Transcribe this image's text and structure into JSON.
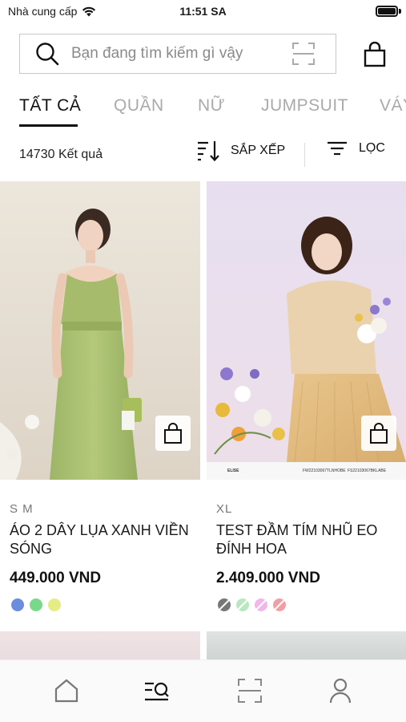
{
  "status_bar": {
    "carrier": "Nhà cung cấp",
    "time": "11:51 SA"
  },
  "search": {
    "placeholder": "Bạn đang tìm kiếm gì vậy",
    "value": ""
  },
  "tabs": [
    {
      "label": "TẤT CẢ",
      "active": true
    },
    {
      "label": "QUẦN",
      "active": false
    },
    {
      "label": "NỮ",
      "active": false
    },
    {
      "label": "JUMPSUIT",
      "active": false
    },
    {
      "label": "VÁY",
      "active": false
    }
  ],
  "results": {
    "count_label": "14730 Kết quả"
  },
  "sort_label": "SẮP XẾP",
  "filter_label": "LỌC",
  "products": [
    {
      "sizes": "S  M",
      "name": "ÁO 2 DÂY LỤA XANH VIỀN SÓNG",
      "price": "449.000 VND",
      "colors": [
        {
          "hex": "#6b8de0",
          "unavailable": false
        },
        {
          "hex": "#78d98b",
          "unavailable": false
        },
        {
          "hex": "#e5ec84",
          "unavailable": false
        }
      ]
    },
    {
      "sizes": "XL",
      "name": "TEST ĐẦM TÍM NHŨ EO ĐÍNH HOA",
      "price": "2.409.000 VND",
      "image_caption": {
        "brand": "ELISE",
        "code_left": "FW22103067TLNHOBE",
        "code_right": "FS22103067BKLABE"
      },
      "colors": [
        {
          "hex": "#777777",
          "unavailable": true
        },
        {
          "hex": "#b8e8c0",
          "unavailable": true
        },
        {
          "hex": "#f0b8e8",
          "unavailable": true
        },
        {
          "hex": "#f0a0a4",
          "unavailable": true
        }
      ]
    }
  ],
  "bottom_nav": [
    "home-icon",
    "search-list-icon",
    "scan-icon",
    "user-icon"
  ]
}
